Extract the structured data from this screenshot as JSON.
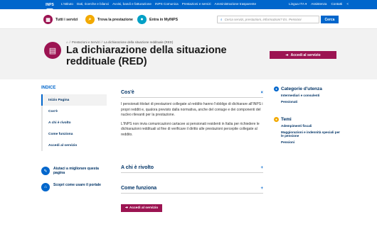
{
  "topbar": {
    "logo": "INPS",
    "links": [
      "L'Istituto",
      "Dati, ricerche e bilanci",
      "Avvisi, bandi e fatturazione",
      "INPS Comunica",
      "Prestazioni e servizi",
      "Amministrazione trasparente"
    ],
    "language": "Lingua ITA",
    "assistance": "Assistenza",
    "contacts": "Contatti"
  },
  "navbar": {
    "items": [
      {
        "label": "Tutti i servizi",
        "icon": "grid-icon",
        "color": "#9c1452"
      },
      {
        "label": "Trova la prestazione",
        "icon": "search-icon",
        "color": "#f2a900"
      },
      {
        "label": "Entra in MyINPS",
        "icon": "user-icon",
        "color": "#00a0c6"
      }
    ],
    "search_placeholder": "Cerca servizi, prestazioni, informazioni? Es. Pensioni",
    "search_button": "Cerca"
  },
  "hero": {
    "breadcrumb": [
      "Prestazioni e Servizi",
      "La dichiarazione della situazione reddituale (RED)"
    ],
    "title": "La dichiarazione della situazione reddituale (RED)",
    "access_button": "Accedi al servizio"
  },
  "index": {
    "title": "INDICE",
    "items": [
      "Inizio Pagina",
      "Cos'è",
      "A chi è rivolto",
      "Come funziona",
      "Accedi al servizio"
    ]
  },
  "help": [
    {
      "label": "Aiutaci a migliorare questa pagina",
      "icon": "chat-icon"
    },
    {
      "label": "Scopri come usare il portale",
      "icon": "home-icon"
    }
  ],
  "sections": {
    "cose": {
      "title": "Cos'è",
      "toggle": "×",
      "paragraphs": [
        "I pensionati titolari di prestazioni collegate al reddito hanno l'obbligo di dichiarare all'INPS i propri redditi e, qualora previsto dalla normativa, anche del coniuge e dei componenti del nucleo rilevanti per la prestazione.",
        "L'INPS non invia comunicazioni cartacee ai pensionati residenti in Italia per richiedere le dichiarazioni reddituali al fine di verificare il diritto alle prestazioni percepite collegate al reddito."
      ]
    },
    "chi": {
      "title": "A chi è rivolto",
      "toggle": "+"
    },
    "come": {
      "title": "Come funziona",
      "toggle": "+"
    }
  },
  "bottom_button": "Accedi al servizio",
  "sidebar": {
    "categories": {
      "title": "Categorie d'utenza",
      "links": [
        "Intermediari e consulenti",
        "Pensionati"
      ]
    },
    "topics": {
      "title": "Temi",
      "links": [
        "Adempimenti fiscali",
        "Maggiorazioni e indennità speciali per le pensione",
        "Pensioni"
      ]
    }
  }
}
